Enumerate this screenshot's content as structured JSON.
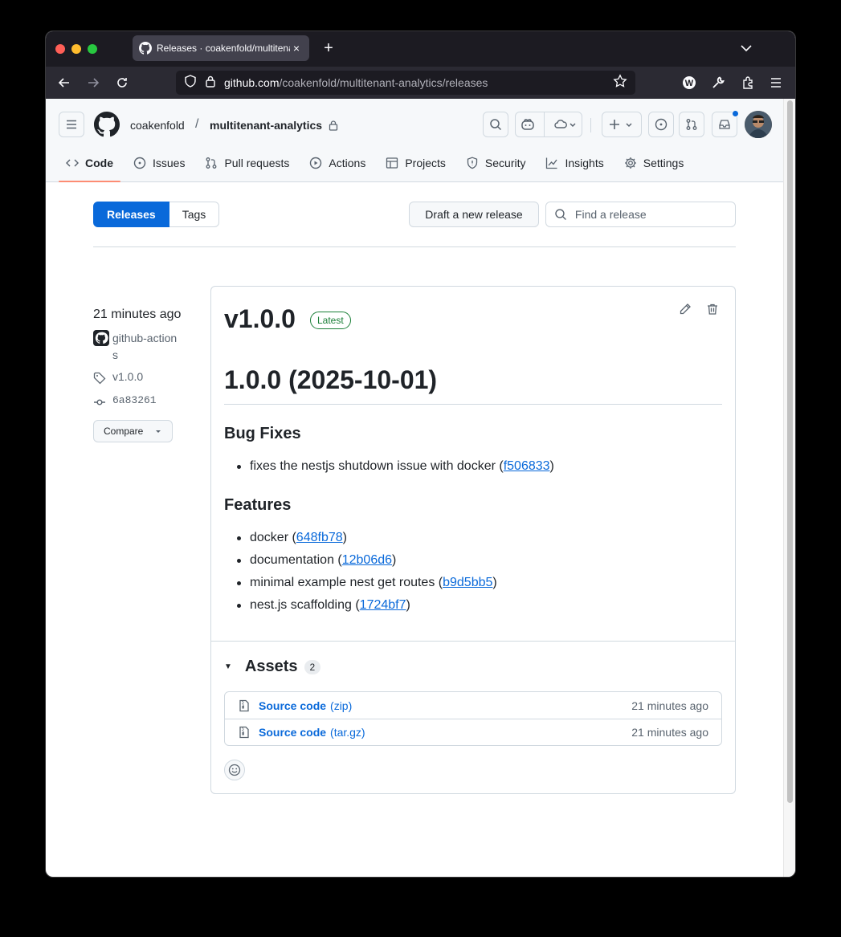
{
  "browser": {
    "tab_title": "Releases · coakenfold/multitenant-analytics",
    "tab_close": "×",
    "new_tab": "+",
    "url_domain": "github.com",
    "url_path": "/coakenfold/multitenant-analytics/releases"
  },
  "repo": {
    "owner": "coakenfold",
    "separator": "/",
    "name": "multitenant-analytics"
  },
  "repo_nav": [
    {
      "label": "Code",
      "icon": "code-icon"
    },
    {
      "label": "Issues",
      "icon": "issue-icon"
    },
    {
      "label": "Pull requests",
      "icon": "pull-request-icon"
    },
    {
      "label": "Actions",
      "icon": "play-icon"
    },
    {
      "label": "Projects",
      "icon": "table-icon"
    },
    {
      "label": "Security",
      "icon": "shield-icon"
    },
    {
      "label": "Insights",
      "icon": "graph-icon"
    },
    {
      "label": "Settings",
      "icon": "gear-icon"
    }
  ],
  "toolbar": {
    "releases_tab": "Releases",
    "tags_tab": "Tags",
    "draft_button": "Draft a new release",
    "find_placeholder": "Find a release"
  },
  "release": {
    "time": "21 minutes ago",
    "author": "github-actions",
    "tag": "v1.0.0",
    "commit": "6a83261",
    "compare": "Compare",
    "title": "v1.0.0",
    "badge": "Latest",
    "heading": "1.0.0 (2025-10-01)",
    "bug_fixes_title": "Bug Fixes",
    "bug_fixes": [
      {
        "text": "fixes the nestjs shutdown issue with docker (",
        "link": "f506833",
        "close": ")"
      }
    ],
    "features_title": "Features",
    "features": [
      {
        "text": "docker (",
        "link": "648fb78",
        "close": ")"
      },
      {
        "text": "documentation (",
        "link": "12b06d6",
        "close": ")"
      },
      {
        "text": "minimal example nest get routes (",
        "link": "b9d5bb5",
        "close": ")"
      },
      {
        "text": "nest.js scaffolding (",
        "link": "1724bf7",
        "close": ")"
      }
    ],
    "assets_caret": "▼",
    "assets_title": "Assets",
    "assets_count": "2",
    "assets": [
      {
        "name": "Source code",
        "format": "(zip)",
        "time": "21 minutes ago"
      },
      {
        "name": "Source code",
        "format": "(tar.gz)",
        "time": "21 minutes ago"
      }
    ]
  },
  "colors": {
    "accent": "#0969da",
    "latest_green": "#1a7f37",
    "underline_active": "#fd8c73",
    "notification_dot": "#0969da"
  }
}
